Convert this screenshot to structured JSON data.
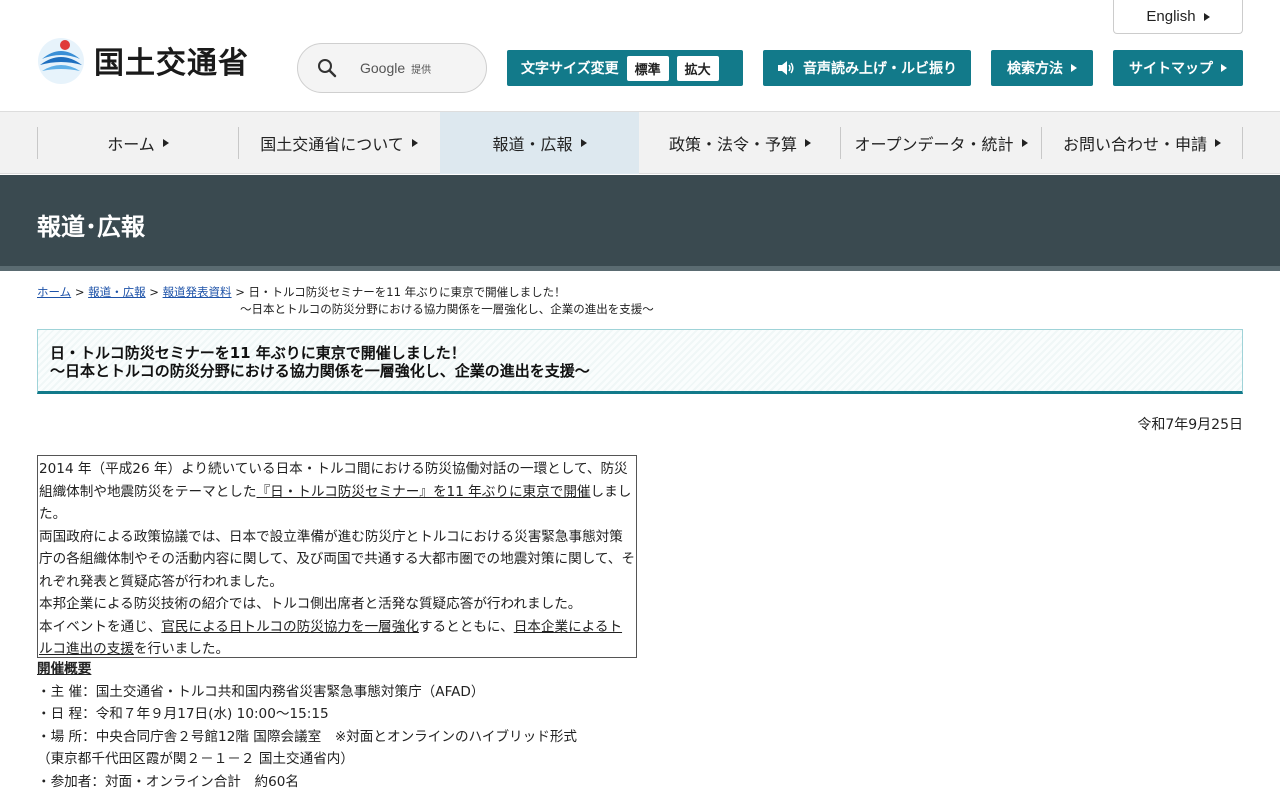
{
  "header": {
    "logo_text": "国土交通省",
    "search_brand": "Google",
    "search_sub": "提供",
    "english_label": "English",
    "font_size_label": "文字サイズ変更",
    "font_size_options": [
      "標準",
      "拡大"
    ],
    "speech_label": "音声読み上げ・ルビ振り",
    "howto_label": "検索方法",
    "sitemap_label": "サイトマップ",
    "accent_color": "#127a8a"
  },
  "gnav": {
    "items": [
      "ホーム",
      "国土交通省について",
      "報道・広報",
      "政策・法令・予算",
      "オープンデータ・統計",
      "お問い合わせ・申請"
    ],
    "active": "報道・広報"
  },
  "category": {
    "title": "報道･広報"
  },
  "breadcrumb": {
    "items": [
      "ホーム",
      "報道・広報",
      "報道発表資料"
    ],
    "separator": ">",
    "current_line1": "日・トルコ防災セミナーを11 年ぶりに東京で開催しました！",
    "current_line2": "～日本とトルコの防災分野における協力関係を一層強化し、企業の進出を支援～"
  },
  "article": {
    "title_line1": "日・トルコ防災セミナーを11 年ぶりに東京で開催しました！",
    "title_line2": "～日本とトルコの防災分野における協力関係を一層強化し、企業の進出を支援～",
    "date": "令和7年9月25日",
    "summary": {
      "p1_a": "2014 年（平成26 年）より続いている日本・トルコ間における防災協働対話の一環として、防災組織体制や地震防災をテーマとした",
      "p1_link": "『日・トルコ防災セミナー』を11 年ぶりに東京で開催",
      "p1_b": "しました。",
      "p2": "両国政府による政策協議では、日本で設立準備が進む防災庁とトルコにおける災害緊急事態対策庁の各組織体制やその活動内容に関して、及び両国で共通する大都市圏での地震対策に関して、それぞれ発表と質疑応答が行われました。",
      "p3": "本邦企業による防災技術の紹介では、トルコ側出席者と活発な質疑応答が行われました。",
      "p4_a": "本イベントを通じ、",
      "p4_u1": "官民による日トルコの防災協力を一層強化",
      "p4_b": "するとともに、",
      "p4_u2": "日本企業によるトルコ進出の支援",
      "p4_c": "を行いました。"
    },
    "details_head": "開催概要",
    "details": [
      "・主 催：国土交通省・トルコ共和国内務省災害緊急事態対策庁（AFAD）",
      "・日 程：令和７年９月17日(水) 10:00～15:15",
      "・場 所：中央合同庁舎２号館12階 国際会議室　※対面とオンラインのハイブリッド形式",
      "（東京都千代田区霞が関２－１－２ 国土交通省内）",
      "・参加者：対面・オンライン合計　約60名"
    ]
  }
}
